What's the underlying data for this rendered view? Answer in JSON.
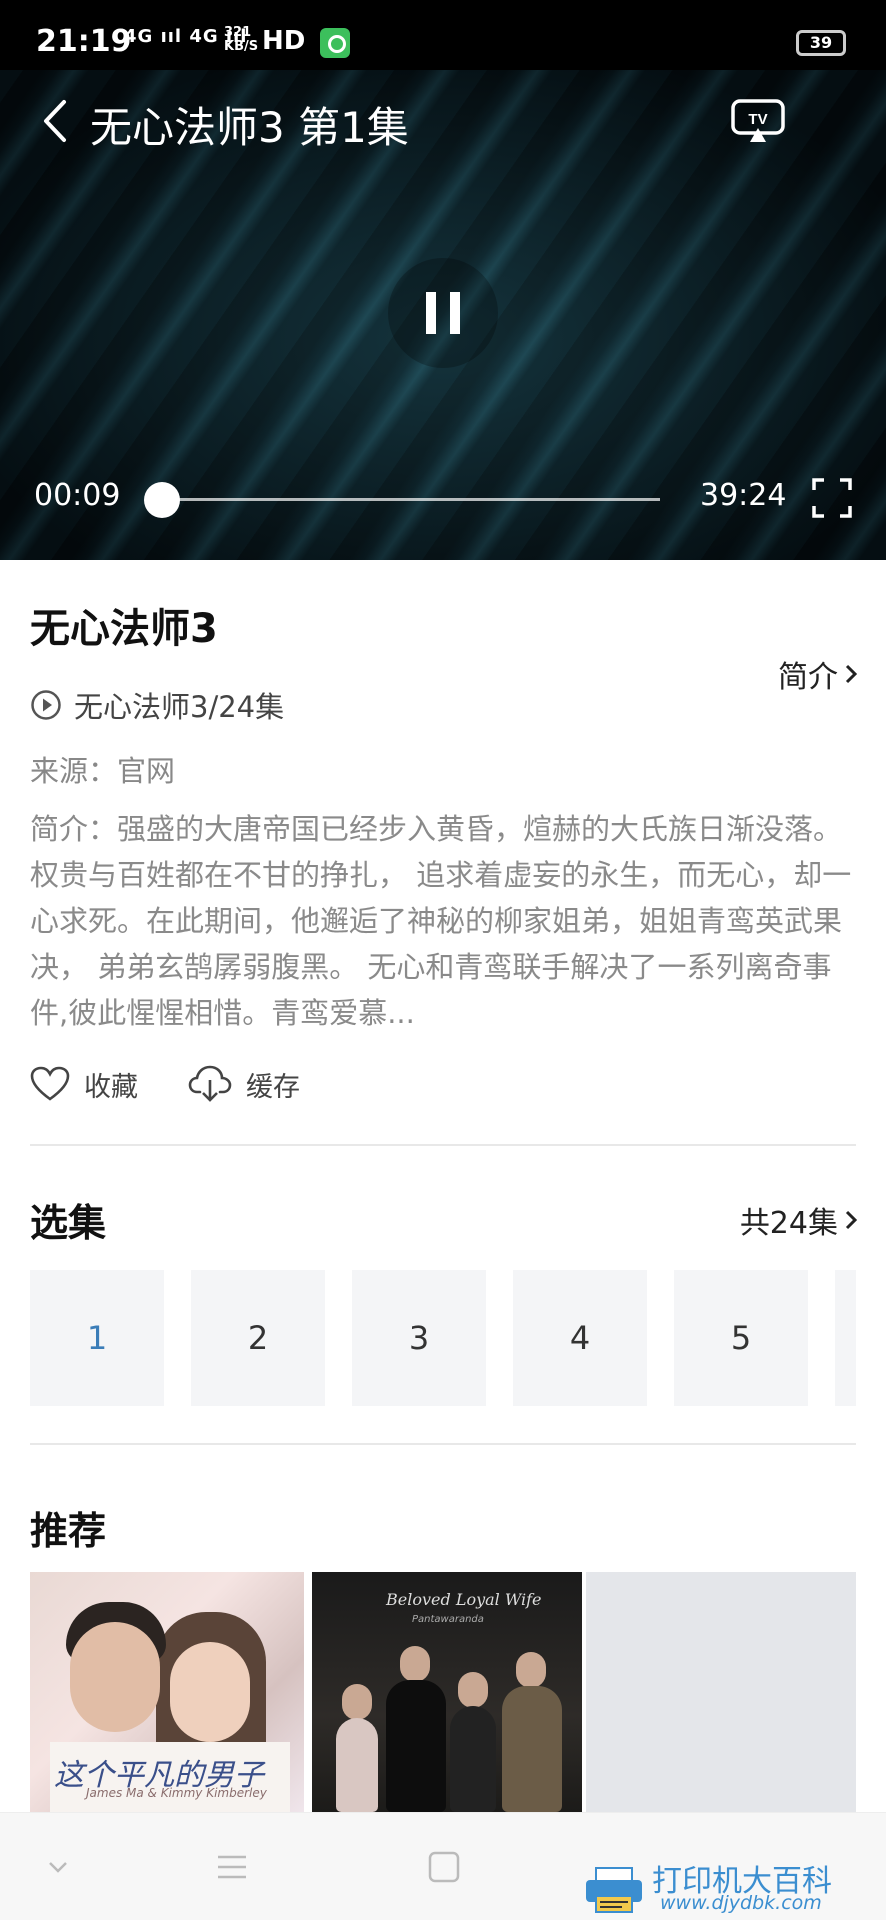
{
  "status_bar": {
    "time": "21:19",
    "signals": "4G ııl 4G ııl",
    "net_speed_value": "321",
    "net_speed_unit": "KB/S",
    "hd": "HD",
    "battery": "39"
  },
  "player": {
    "title": "无心法师3 第1集",
    "current_time": "00:09",
    "total_time": "39:24",
    "progress_fraction": 0.004,
    "icons": [
      "back-icon",
      "tv-cast-icon",
      "pause-icon",
      "fullscreen-icon"
    ]
  },
  "info": {
    "show_title": "无心法师3",
    "intro_link": "简介",
    "episode_info": "无心法师3/24集",
    "source": "来源：官网",
    "synopsis": "简介：强盛的大唐帝国已经步入黄昏，煊赫的大氏族日渐没落。权贵与百姓都在不甘的挣扎， 追求着虚妄的永生，而无心，却一心求死。在此期间，他邂逅了神秘的柳家姐弟，姐姐青鸾英武果决， 弟弟玄鹄孱弱腹黑。 无心和青鸾联手解决了一系列离奇事件,彼此惺惺相惜。青鸾爱慕..."
  },
  "actions": {
    "favorite_label": "收藏",
    "cache_label": "缓存"
  },
  "episodes": {
    "section_title": "选集",
    "count_label": "共24集",
    "items": [
      "1",
      "2",
      "3",
      "4",
      "5"
    ],
    "active_index": 0
  },
  "recommend": {
    "section_title": "推荐",
    "posters": [
      {
        "caption": "这个平凡的男子",
        "sub": "James Ma & Kimmy Kimberley"
      },
      {
        "caption": "Beloved Loyal Wife",
        "sub": "Pantawaranda"
      },
      {
        "caption": ""
      }
    ]
  },
  "watermark": {
    "line1": "打印机大百科",
    "line2": "www.djydbk.com"
  },
  "colors": {
    "accent": "#3b7db8",
    "episode_bg": "#f4f5f7",
    "muted_text": "#8a8a8a"
  }
}
